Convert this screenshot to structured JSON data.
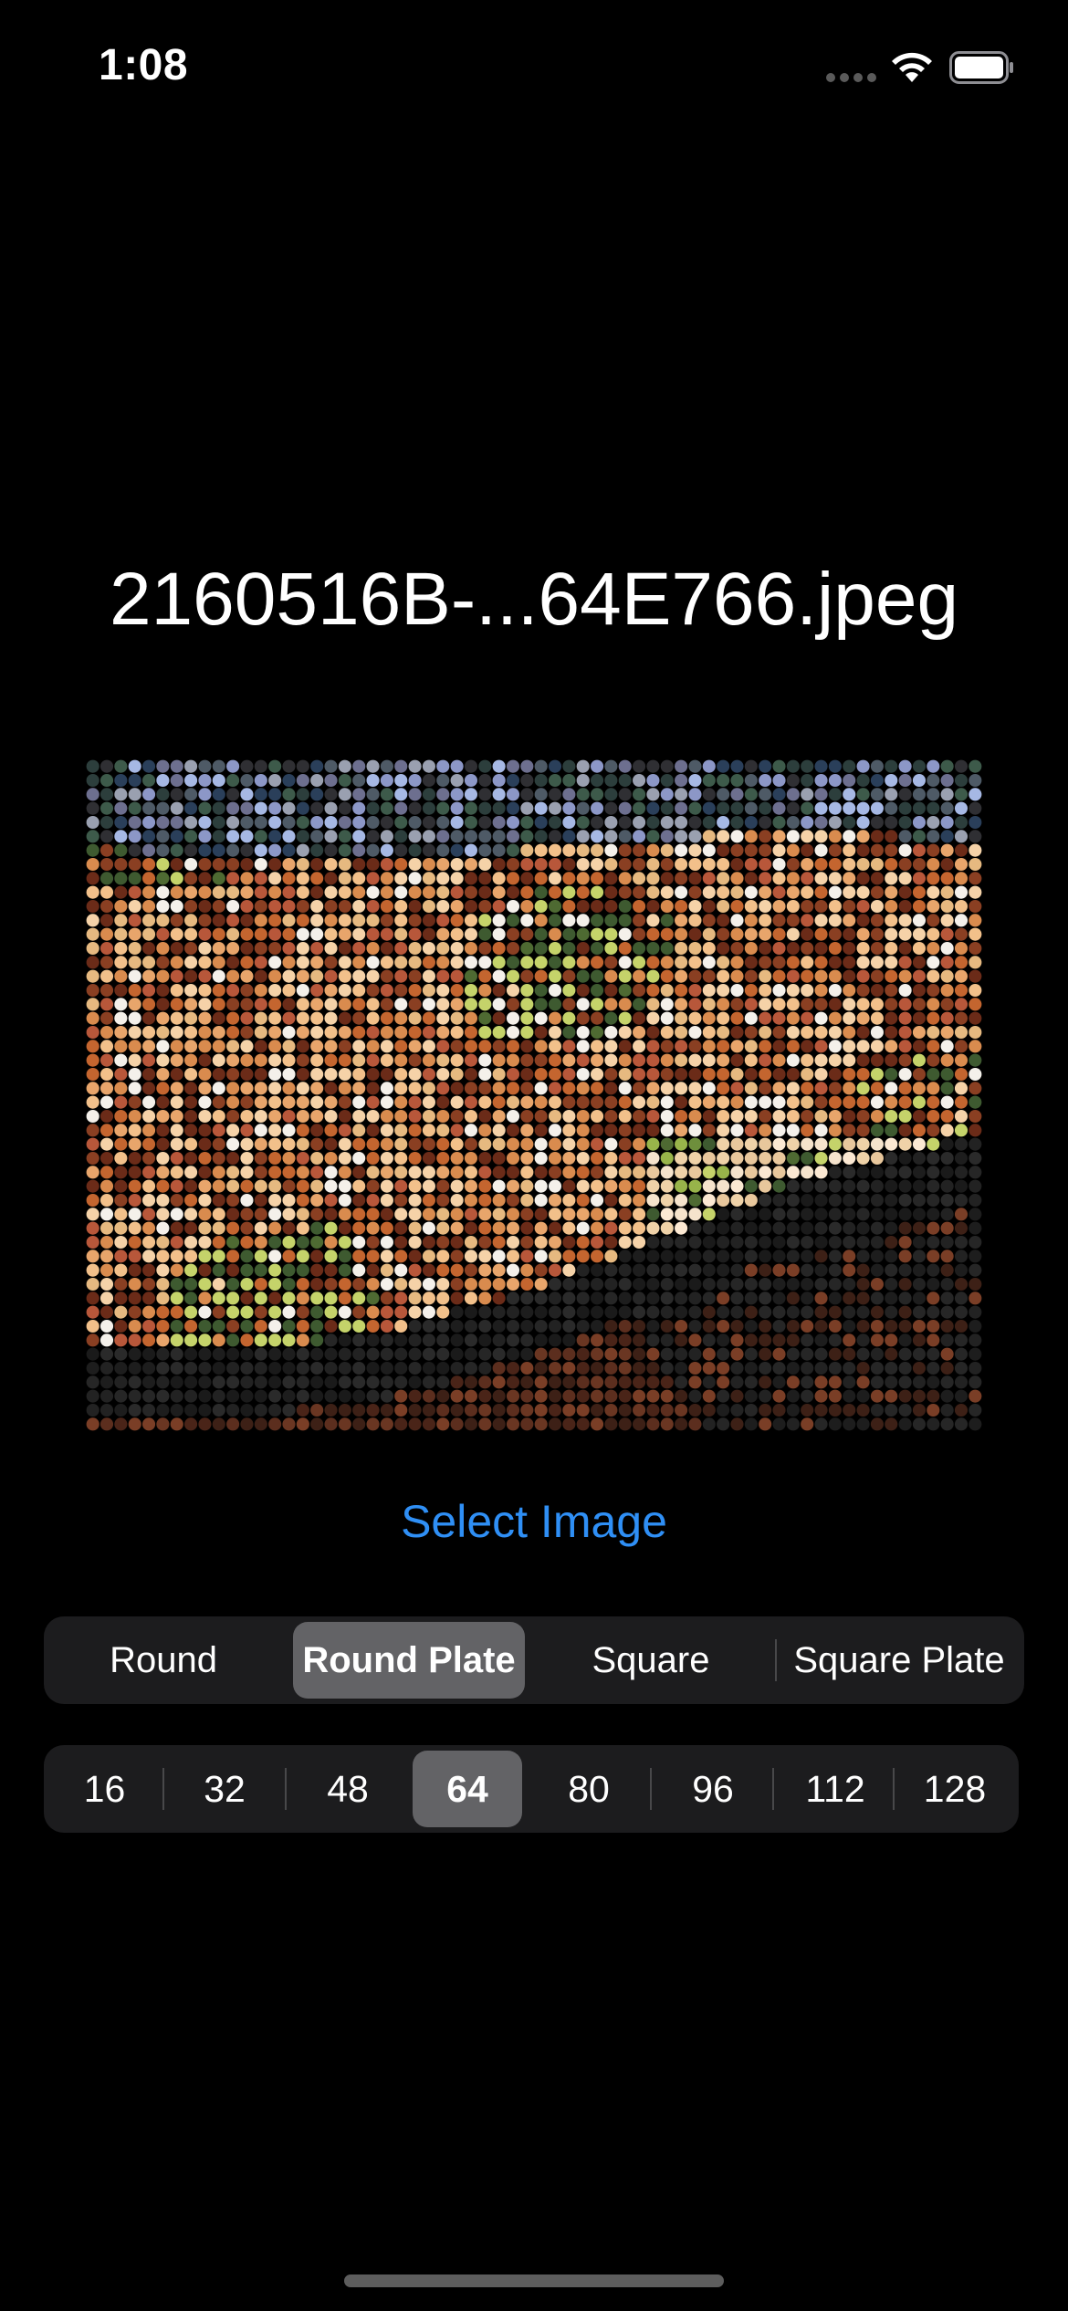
{
  "status_bar": {
    "time": "1:08",
    "icons": [
      "cellular-dots-icon",
      "wifi-icon",
      "battery-icon"
    ]
  },
  "title": "2160516B-...64E766.jpeg",
  "image": {
    "description_icon": "mosaic-preview",
    "grid_columns": 64,
    "grid_rows": 48
  },
  "select_image_label": "Select Image",
  "accent_color": "#2f8ff5",
  "shape_picker": {
    "options": [
      "Round",
      "Round Plate",
      "Square",
      "Square Plate"
    ],
    "selected": "Round Plate"
  },
  "size_picker": {
    "options": [
      "16",
      "32",
      "48",
      "64",
      "80",
      "96",
      "112",
      "128"
    ],
    "selected": "64"
  }
}
